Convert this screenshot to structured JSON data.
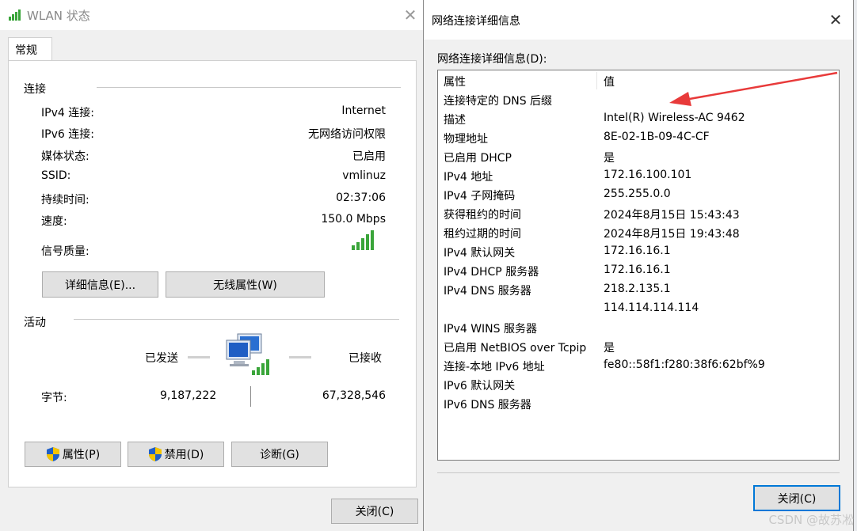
{
  "wlan_window": {
    "title": "WLAN 状态",
    "tab": "常规",
    "connection_section": "连接",
    "rows": [
      {
        "label": "IPv4 连接:",
        "value": "Internet"
      },
      {
        "label": "IPv6 连接:",
        "value": "无网络访问权限"
      },
      {
        "label": "媒体状态:",
        "value": "已启用"
      },
      {
        "label": "SSID:",
        "value": "vmlinuz"
      },
      {
        "label": "持续时间:",
        "value": "02:37:06"
      },
      {
        "label": "速度:",
        "value": "150.0 Mbps"
      }
    ],
    "signal_label": "信号质量:",
    "details_button": "详细信息(E)...",
    "wireless_props_button": "无线属性(W)",
    "activity_section": "活动",
    "sent_label": "已发送",
    "received_label": "已接收",
    "bytes_label": "字节:",
    "bytes_sent": "9,187,222",
    "bytes_received": "67,328,546",
    "properties_button": "属性(P)",
    "disable_button": "禁用(D)",
    "diagnose_button": "诊断(G)",
    "close_button": "关闭(C)"
  },
  "details_window": {
    "title": "网络连接详细信息",
    "list_label": "网络连接详细信息(D):",
    "col_property": "属性",
    "col_value": "值",
    "rows": [
      {
        "property": "连接特定的 DNS 后缀",
        "value": ""
      },
      {
        "property": "描述",
        "value": "Intel(R) Wireless-AC 9462"
      },
      {
        "property": "物理地址",
        "value": "8E-02-1B-09-4C-CF"
      },
      {
        "property": "已启用 DHCP",
        "value": "是"
      },
      {
        "property": "IPv4 地址",
        "value": "172.16.100.101"
      },
      {
        "property": "IPv4 子网掩码",
        "value": "255.255.0.0"
      },
      {
        "property": "获得租约的时间",
        "value": "2024年8月15日 15:43:43"
      },
      {
        "property": "租约过期的时间",
        "value": "2024年8月15日 19:43:48"
      },
      {
        "property": "IPv4 默认网关",
        "value": "172.16.16.1"
      },
      {
        "property": "IPv4 DHCP 服务器",
        "value": "172.16.16.1"
      },
      {
        "property": "IPv4 DNS 服务器",
        "value": "218.2.135.1"
      },
      {
        "property": "",
        "value": "114.114.114.114"
      },
      {
        "property": "IPv4 WINS 服务器",
        "value": ""
      },
      {
        "property": "已启用 NetBIOS over Tcpip",
        "value": "是"
      },
      {
        "property": "连接-本地 IPv6 地址",
        "value": "fe80::58f1:f280:38f6:62bf%9"
      },
      {
        "property": "IPv6 默认网关",
        "value": ""
      },
      {
        "property": "IPv6 DNS 服务器",
        "value": ""
      }
    ],
    "close_button": "关闭(C)"
  },
  "watermark": "CSDN @故苏凇",
  "colors": {
    "accent": "#0078d7",
    "signal": "#3aa53a",
    "arrow": "#e83a3a"
  },
  "icons": [
    "wifi-signal-icon",
    "close-icon",
    "network-computers-icon",
    "uac-shield-icon",
    "red-arrow"
  ]
}
